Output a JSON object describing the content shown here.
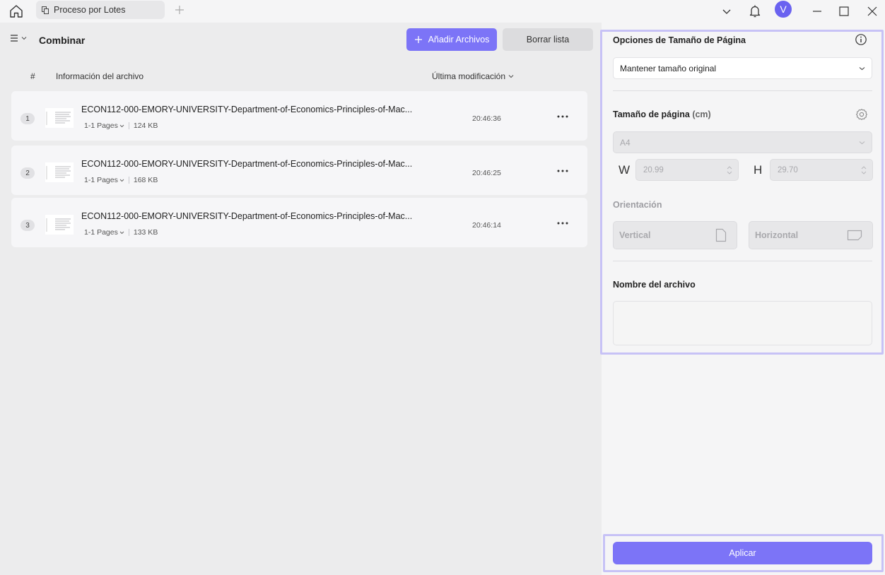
{
  "titlebar": {
    "tab_label": "Proceso por Lotes",
    "avatar_letter": "V"
  },
  "toolbar": {
    "title": "Combinar",
    "add_files_label": "Añadir Archivos",
    "clear_list_label": "Borrar lista"
  },
  "table": {
    "col_number": "#",
    "col_info": "Información del archivo",
    "col_modified": "Última modificación"
  },
  "files": [
    {
      "num": "1",
      "name": "ECON112-000-EMORY-UNIVERSITY-Department-of-Economics-Principles-of-Mac...",
      "pages": "1-1 Pages",
      "size": "124 KB",
      "time": "20:46:36"
    },
    {
      "num": "2",
      "name": "ECON112-000-EMORY-UNIVERSITY-Department-of-Economics-Principles-of-Mac...",
      "pages": "1-1 Pages",
      "size": "168 KB",
      "time": "20:46:25"
    },
    {
      "num": "3",
      "name": "ECON112-000-EMORY-UNIVERSITY-Department-of-Economics-Principles-of-Mac...",
      "pages": "1-1 Pages",
      "size": "133 KB",
      "time": "20:46:14"
    }
  ],
  "panel": {
    "size_options_title": "Opciones de Tamaño de Página",
    "size_mode_value": "Mantener tamaño original",
    "page_size_title": "Tamaño de página",
    "page_size_unit": "(cm)",
    "paper_value": "A4",
    "width_label": "W",
    "width_value": "20.99",
    "height_label": "H",
    "height_value": "29.70",
    "orientation_title": "Orientación",
    "vertical_label": "Vertical",
    "horizontal_label": "Horizontal",
    "filename_title": "Nombre del archivo",
    "filename_value": "",
    "apply_label": "Aplicar"
  },
  "colors": {
    "accent": "#7c74f7",
    "highlight": "#c7c2f6"
  }
}
